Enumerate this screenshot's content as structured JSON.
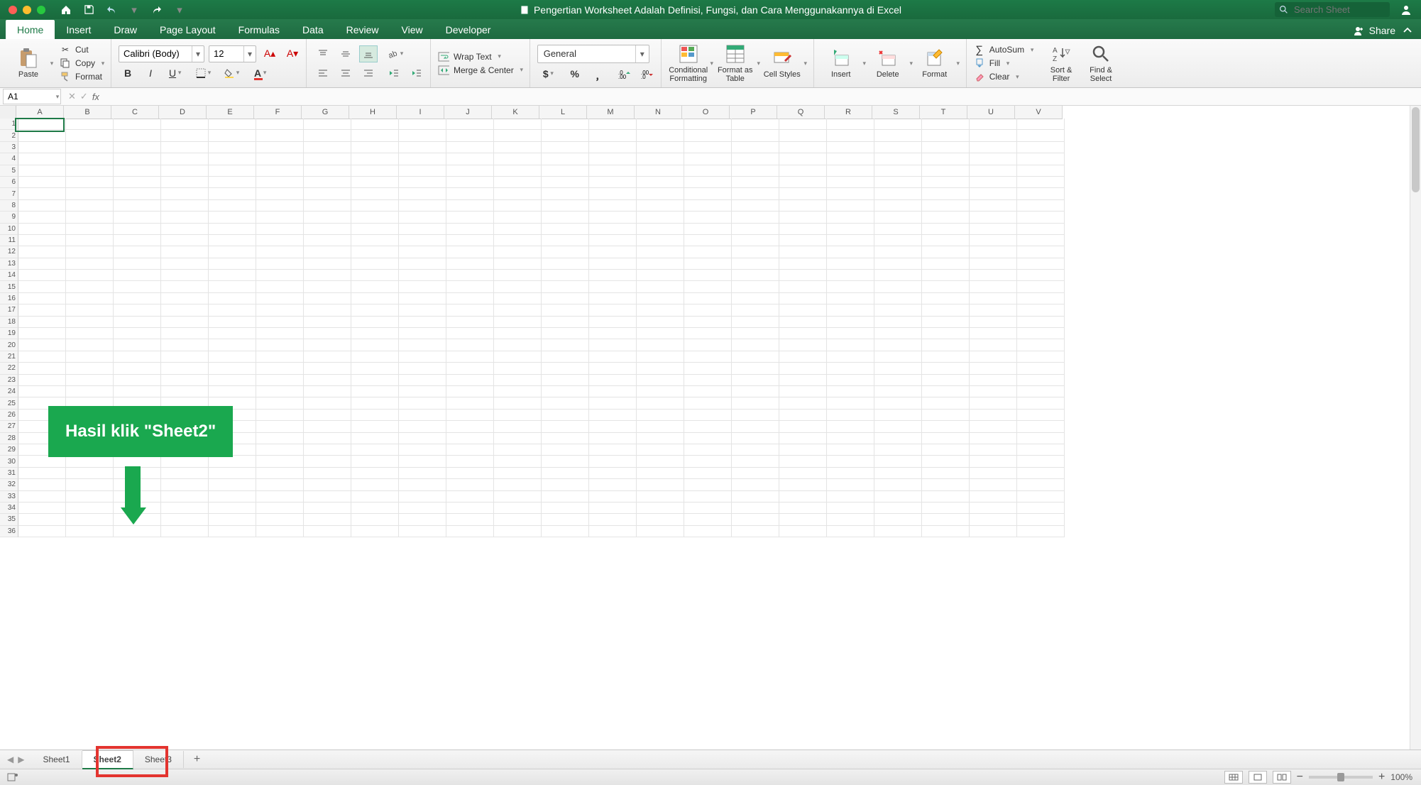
{
  "titlebar": {
    "title": "Pengertian Worksheet Adalah Definisi, Fungsi, dan Cara Menggunakannya di Excel",
    "search_placeholder": "Search Sheet"
  },
  "tabs": {
    "items": [
      "Home",
      "Insert",
      "Draw",
      "Page Layout",
      "Formulas",
      "Data",
      "Review",
      "View",
      "Developer"
    ],
    "active_index": 0,
    "share_label": "Share"
  },
  "ribbon": {
    "clipboard": {
      "paste": "Paste",
      "cut": "Cut",
      "copy": "Copy",
      "format": "Format"
    },
    "font": {
      "name": "Calibri (Body)",
      "size": "12"
    },
    "alignment": {
      "wrap": "Wrap Text",
      "merge": "Merge & Center"
    },
    "number": {
      "format": "General"
    },
    "styles": {
      "cond": "Conditional Formatting",
      "table": "Format as Table",
      "cell": "Cell Styles"
    },
    "cells": {
      "insert": "Insert",
      "delete": "Delete",
      "format": "Format"
    },
    "editing": {
      "autosum": "AutoSum",
      "fill": "Fill",
      "clear": "Clear",
      "sort": "Sort & Filter",
      "find": "Find & Select"
    }
  },
  "formula_bar": {
    "cell_ref": "A1",
    "formula": ""
  },
  "columns": [
    "A",
    "B",
    "C",
    "D",
    "E",
    "F",
    "G",
    "H",
    "I",
    "J",
    "K",
    "L",
    "M",
    "N",
    "O",
    "P",
    "Q",
    "R",
    "S",
    "T",
    "U",
    "V"
  ],
  "row_count": 36,
  "selection": {
    "col": 0,
    "row": 0
  },
  "annotation": {
    "text": "Hasil klik \"Sheet2\""
  },
  "sheets": {
    "items": [
      "Sheet1",
      "Sheet2",
      "Sheet3"
    ],
    "active_index": 1
  },
  "status": {
    "zoom": "100%"
  }
}
